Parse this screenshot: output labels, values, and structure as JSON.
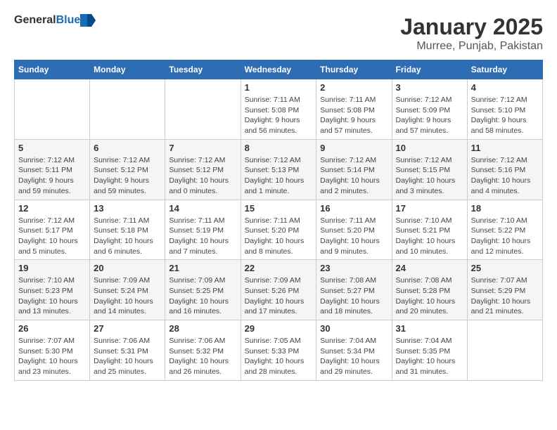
{
  "header": {
    "logo_general": "General",
    "logo_blue": "Blue",
    "month": "January 2025",
    "location": "Murree, Punjab, Pakistan"
  },
  "weekdays": [
    "Sunday",
    "Monday",
    "Tuesday",
    "Wednesday",
    "Thursday",
    "Friday",
    "Saturday"
  ],
  "weeks": [
    [
      {
        "day": "",
        "info": ""
      },
      {
        "day": "",
        "info": ""
      },
      {
        "day": "",
        "info": ""
      },
      {
        "day": "1",
        "info": "Sunrise: 7:11 AM\nSunset: 5:08 PM\nDaylight: 9 hours and 56 minutes."
      },
      {
        "day": "2",
        "info": "Sunrise: 7:11 AM\nSunset: 5:08 PM\nDaylight: 9 hours and 57 minutes."
      },
      {
        "day": "3",
        "info": "Sunrise: 7:12 AM\nSunset: 5:09 PM\nDaylight: 9 hours and 57 minutes."
      },
      {
        "day": "4",
        "info": "Sunrise: 7:12 AM\nSunset: 5:10 PM\nDaylight: 9 hours and 58 minutes."
      }
    ],
    [
      {
        "day": "5",
        "info": "Sunrise: 7:12 AM\nSunset: 5:11 PM\nDaylight: 9 hours and 59 minutes."
      },
      {
        "day": "6",
        "info": "Sunrise: 7:12 AM\nSunset: 5:12 PM\nDaylight: 9 hours and 59 minutes."
      },
      {
        "day": "7",
        "info": "Sunrise: 7:12 AM\nSunset: 5:12 PM\nDaylight: 10 hours and 0 minutes."
      },
      {
        "day": "8",
        "info": "Sunrise: 7:12 AM\nSunset: 5:13 PM\nDaylight: 10 hours and 1 minute."
      },
      {
        "day": "9",
        "info": "Sunrise: 7:12 AM\nSunset: 5:14 PM\nDaylight: 10 hours and 2 minutes."
      },
      {
        "day": "10",
        "info": "Sunrise: 7:12 AM\nSunset: 5:15 PM\nDaylight: 10 hours and 3 minutes."
      },
      {
        "day": "11",
        "info": "Sunrise: 7:12 AM\nSunset: 5:16 PM\nDaylight: 10 hours and 4 minutes."
      }
    ],
    [
      {
        "day": "12",
        "info": "Sunrise: 7:12 AM\nSunset: 5:17 PM\nDaylight: 10 hours and 5 minutes."
      },
      {
        "day": "13",
        "info": "Sunrise: 7:11 AM\nSunset: 5:18 PM\nDaylight: 10 hours and 6 minutes."
      },
      {
        "day": "14",
        "info": "Sunrise: 7:11 AM\nSunset: 5:19 PM\nDaylight: 10 hours and 7 minutes."
      },
      {
        "day": "15",
        "info": "Sunrise: 7:11 AM\nSunset: 5:20 PM\nDaylight: 10 hours and 8 minutes."
      },
      {
        "day": "16",
        "info": "Sunrise: 7:11 AM\nSunset: 5:20 PM\nDaylight: 10 hours and 9 minutes."
      },
      {
        "day": "17",
        "info": "Sunrise: 7:10 AM\nSunset: 5:21 PM\nDaylight: 10 hours and 10 minutes."
      },
      {
        "day": "18",
        "info": "Sunrise: 7:10 AM\nSunset: 5:22 PM\nDaylight: 10 hours and 12 minutes."
      }
    ],
    [
      {
        "day": "19",
        "info": "Sunrise: 7:10 AM\nSunset: 5:23 PM\nDaylight: 10 hours and 13 minutes."
      },
      {
        "day": "20",
        "info": "Sunrise: 7:09 AM\nSunset: 5:24 PM\nDaylight: 10 hours and 14 minutes."
      },
      {
        "day": "21",
        "info": "Sunrise: 7:09 AM\nSunset: 5:25 PM\nDaylight: 10 hours and 16 minutes."
      },
      {
        "day": "22",
        "info": "Sunrise: 7:09 AM\nSunset: 5:26 PM\nDaylight: 10 hours and 17 minutes."
      },
      {
        "day": "23",
        "info": "Sunrise: 7:08 AM\nSunset: 5:27 PM\nDaylight: 10 hours and 18 minutes."
      },
      {
        "day": "24",
        "info": "Sunrise: 7:08 AM\nSunset: 5:28 PM\nDaylight: 10 hours and 20 minutes."
      },
      {
        "day": "25",
        "info": "Sunrise: 7:07 AM\nSunset: 5:29 PM\nDaylight: 10 hours and 21 minutes."
      }
    ],
    [
      {
        "day": "26",
        "info": "Sunrise: 7:07 AM\nSunset: 5:30 PM\nDaylight: 10 hours and 23 minutes."
      },
      {
        "day": "27",
        "info": "Sunrise: 7:06 AM\nSunset: 5:31 PM\nDaylight: 10 hours and 25 minutes."
      },
      {
        "day": "28",
        "info": "Sunrise: 7:06 AM\nSunset: 5:32 PM\nDaylight: 10 hours and 26 minutes."
      },
      {
        "day": "29",
        "info": "Sunrise: 7:05 AM\nSunset: 5:33 PM\nDaylight: 10 hours and 28 minutes."
      },
      {
        "day": "30",
        "info": "Sunrise: 7:04 AM\nSunset: 5:34 PM\nDaylight: 10 hours and 29 minutes."
      },
      {
        "day": "31",
        "info": "Sunrise: 7:04 AM\nSunset: 5:35 PM\nDaylight: 10 hours and 31 minutes."
      },
      {
        "day": "",
        "info": ""
      }
    ]
  ]
}
